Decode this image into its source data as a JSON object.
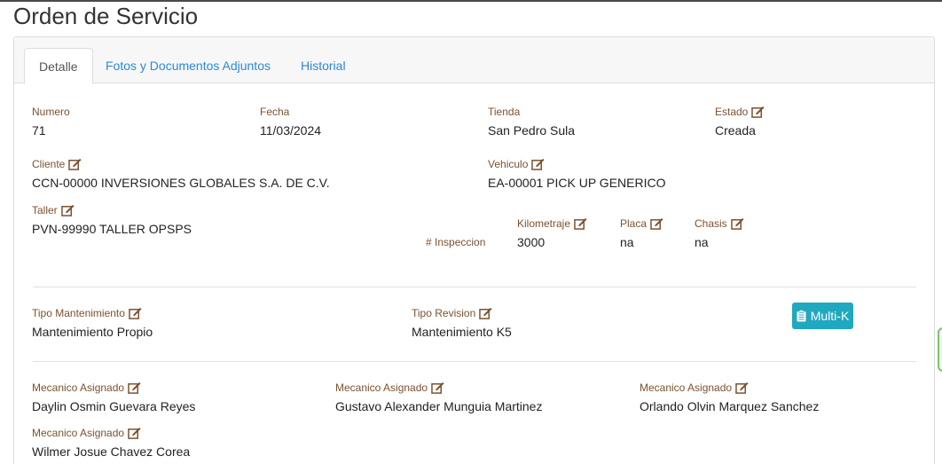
{
  "page": {
    "title": "Orden de Servicio"
  },
  "tabs": [
    {
      "label": "Detalle"
    },
    {
      "label": "Fotos y Documentos Adjuntos"
    },
    {
      "label": "Historial"
    }
  ],
  "fields": {
    "numero": {
      "label": "Numero",
      "value": "71"
    },
    "fecha": {
      "label": "Fecha",
      "value": "11/03/2024"
    },
    "tienda": {
      "label": "Tienda",
      "value": "San Pedro Sula"
    },
    "estado": {
      "label": "Estado",
      "value": "Creada"
    },
    "cliente": {
      "label": "Cliente",
      "value": "CCN-00000 INVERSIONES GLOBALES S.A. DE C.V."
    },
    "vehiculo": {
      "label": "Vehiculo",
      "value": "EA-00001 PICK UP GENERICO"
    },
    "taller": {
      "label": "Taller",
      "value": "PVN-99990 TALLER OPSPS"
    },
    "inspeccion": {
      "label": "# Inspeccion"
    },
    "kilometraje": {
      "label": "Kilometraje",
      "value": "3000"
    },
    "placa": {
      "label": "Placa",
      "value": "na"
    },
    "chasis": {
      "label": "Chasis",
      "value": "na"
    },
    "tipo_mantenimiento": {
      "label": "Tipo Mantenimiento",
      "value": "Mantenimiento Propio"
    },
    "tipo_revision": {
      "label": "Tipo Revision",
      "value": "Mantenimiento K5"
    }
  },
  "multik_button": {
    "label": "Multi-K"
  },
  "mecanicos": [
    {
      "label": "Mecanico Asignado",
      "value": "Daylin Osmin Guevara Reyes"
    },
    {
      "label": "Mecanico Asignado",
      "value": "Gustavo Alexander Munguia Martinez"
    },
    {
      "label": "Mecanico Asignado",
      "value": "Orlando Olvin Marquez Sanchez"
    },
    {
      "label": "Mecanico Asignado",
      "value": "Wilmer Josue Chavez Corea"
    }
  ],
  "colors": {
    "label": "#7a5230",
    "link": "#2a8ad6",
    "button": "#20a8c0"
  },
  "icons": {
    "edit": "edit-icon",
    "clipboard": "clipboard-icon"
  }
}
